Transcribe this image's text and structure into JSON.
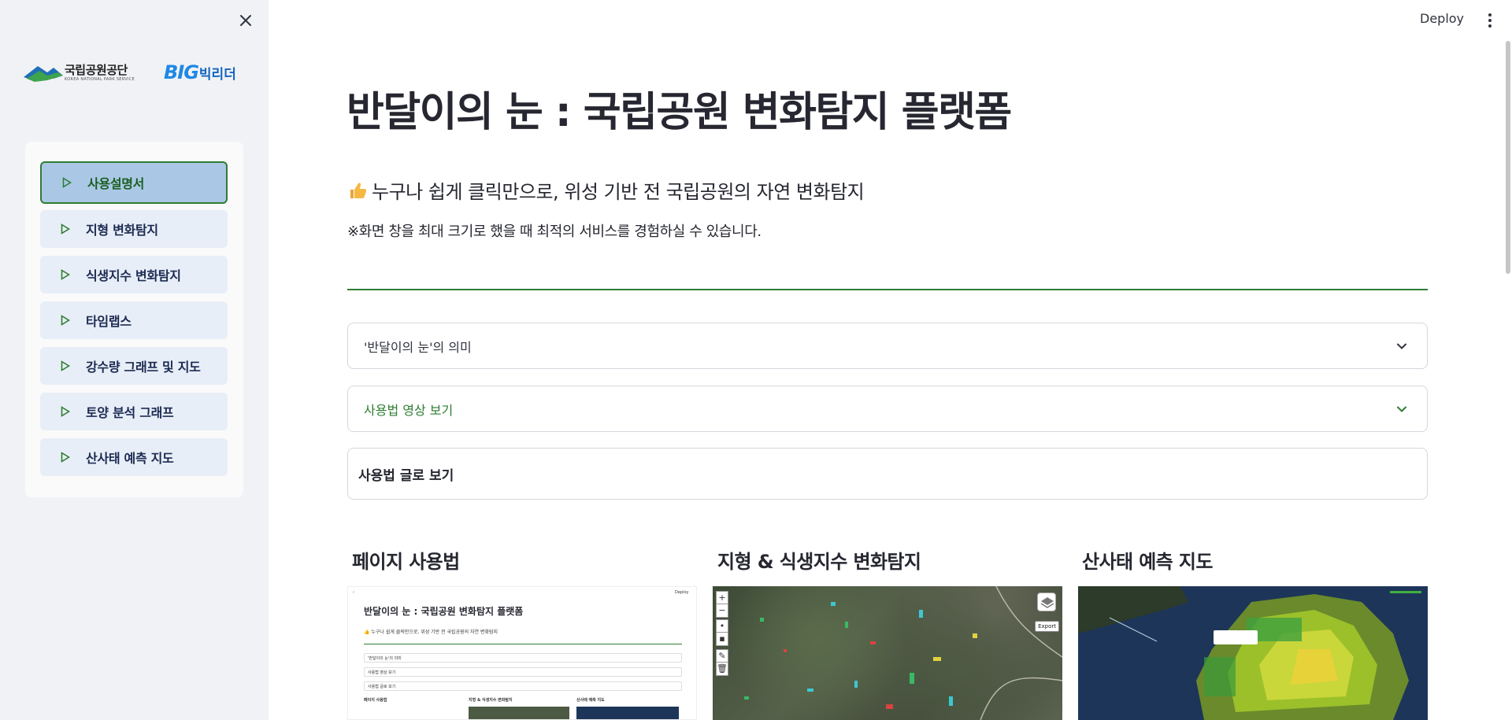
{
  "header": {
    "deploy_label": "Deploy"
  },
  "sidebar": {
    "logos": {
      "knps_name": "국립공원공단",
      "knps_sub": "KOREA NATIONAL PARK SERVICE",
      "bigleader_latin": "BIG",
      "bigleader_korean": "빅리더"
    },
    "items": [
      {
        "label": "사용설명서",
        "active": true
      },
      {
        "label": "지형 변화탐지",
        "active": false
      },
      {
        "label": "식생지수 변화탐지",
        "active": false
      },
      {
        "label": "타임랩스",
        "active": false
      },
      {
        "label": "강수량 그래프 및 지도",
        "active": false
      },
      {
        "label": "토양 분석 그래프",
        "active": false
      },
      {
        "label": "산사태 예측 지도",
        "active": false
      }
    ]
  },
  "main": {
    "title": "반달이의 눈 : 국립공원 변화탐지 플랫폼",
    "subtitle": "누구나 쉽게 클릭만으로, 위성 기반 전 국립공원의 자연 변화탐지",
    "notice": "※화면 창을 최대 크기로 했을 때 최적의 서비스를 경험하실 수 있습니다.",
    "expanders": [
      {
        "label": "'반달이의 눈'의 의미"
      },
      {
        "label": "사용법 영상 보기"
      }
    ],
    "text_guide_label": "사용법 글로 보기",
    "sections": [
      {
        "title": "페이지 사용법"
      },
      {
        "title": "지형 & 식생지수 변화탐지"
      },
      {
        "title": "산사태 예측 지도"
      }
    ],
    "mini_preview": {
      "title": "반달이의 눈 : 국립공원 변화탐지 플랫폼",
      "subtitle": "👍 누구나 쉽게 클릭만으로, 위성 기반 전 국립공원의 자연 변화탐지",
      "expander_1": "'반달이의 눈'의 의미",
      "expander_2": "사용법 영상 보기",
      "text_guide": "사용법 글로 보기",
      "col_1": "페이지 사용법",
      "col_2": "지형 & 식생지수 변화탐지",
      "col_3": "산사태 예측 지도",
      "deploy": "Deploy"
    },
    "map_controls": {
      "zoom_in": "+",
      "zoom_out": "−",
      "export": "Export"
    }
  },
  "colors": {
    "accent_green": "#2e7d32",
    "sidebar_bg": "#f0f2f6",
    "menu_active_bg": "#aac8e6"
  }
}
